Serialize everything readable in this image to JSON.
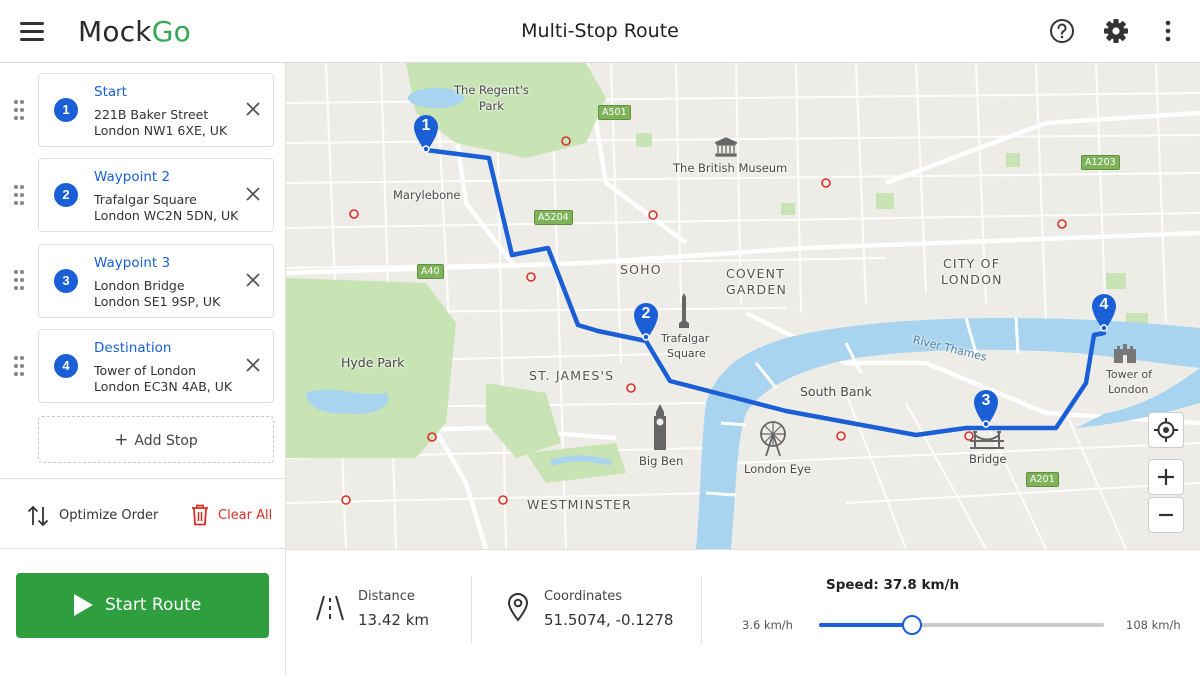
{
  "app": {
    "logo_mock": "Mock",
    "logo_go": "Go",
    "title": "Multi-Stop Route"
  },
  "header": {
    "help_icon": "help-circle-icon",
    "settings_icon": "gear-icon",
    "more_icon": "more-vert-icon"
  },
  "stops": [
    {
      "number": "1",
      "title": "Start",
      "line1": "221B Baker Street",
      "line2": "London NW1 6XE, UK"
    },
    {
      "number": "2",
      "title": "Waypoint 2",
      "line1": "Trafalgar Square",
      "line2": "London WC2N 5DN, UK"
    },
    {
      "number": "3",
      "title": "Waypoint 3",
      "line1": "London Bridge",
      "line2": "London SE1 9SP, UK"
    },
    {
      "number": "4",
      "title": "Destination",
      "line1": "Tower of London",
      "line2": "London EC3N 4AB, UK"
    }
  ],
  "sidebar": {
    "add_stop": "Add Stop",
    "optimize": "Optimize Order",
    "clear_all": "Clear All",
    "start_route": "Start Route"
  },
  "map": {
    "labels": {
      "regents_park_1": "The Regent's",
      "regents_park_2": "Park",
      "marylebone": "Marylebone",
      "british_museum": "The British Museum",
      "soho": "SOHO",
      "covent_garden_1": "COVENT",
      "covent_garden_2": "GARDEN",
      "city_1": "CITY OF",
      "city_2": "LONDON",
      "hyde_park": "Hyde Park",
      "trafalgar_1": "Trafalgar",
      "trafalgar_2": "Square",
      "st_james": "ST. JAMES'S",
      "south_bank": "South Bank",
      "river_thames": "River Thames",
      "tower_1": "Tower of",
      "tower_2": "London",
      "big_ben": "Big Ben",
      "london_eye": "London Eye",
      "bridge": "Bridge",
      "westminster": "WESTMINSTER"
    },
    "roads": {
      "a501": "A501",
      "a5204": "A5204",
      "a40": "A40",
      "a1203": "A1203",
      "a201": "A201"
    },
    "markers": [
      "1",
      "2",
      "3",
      "4"
    ],
    "route_color": "#1a5fd6",
    "water_color": "#a8d4ef",
    "park_color": "#c8e3b4"
  },
  "info": {
    "distance_label": "Distance",
    "distance_value": "13.42 km",
    "coords_label": "Coordinates",
    "coords_value": "51.5074, -0.1278",
    "speed_title": "Speed: 37.8 km/h",
    "speed_min": "3.6 km/h",
    "speed_max": "108 km/h",
    "speed_value": 37.8,
    "speed_min_value": 3.6,
    "speed_max_value": 108
  }
}
